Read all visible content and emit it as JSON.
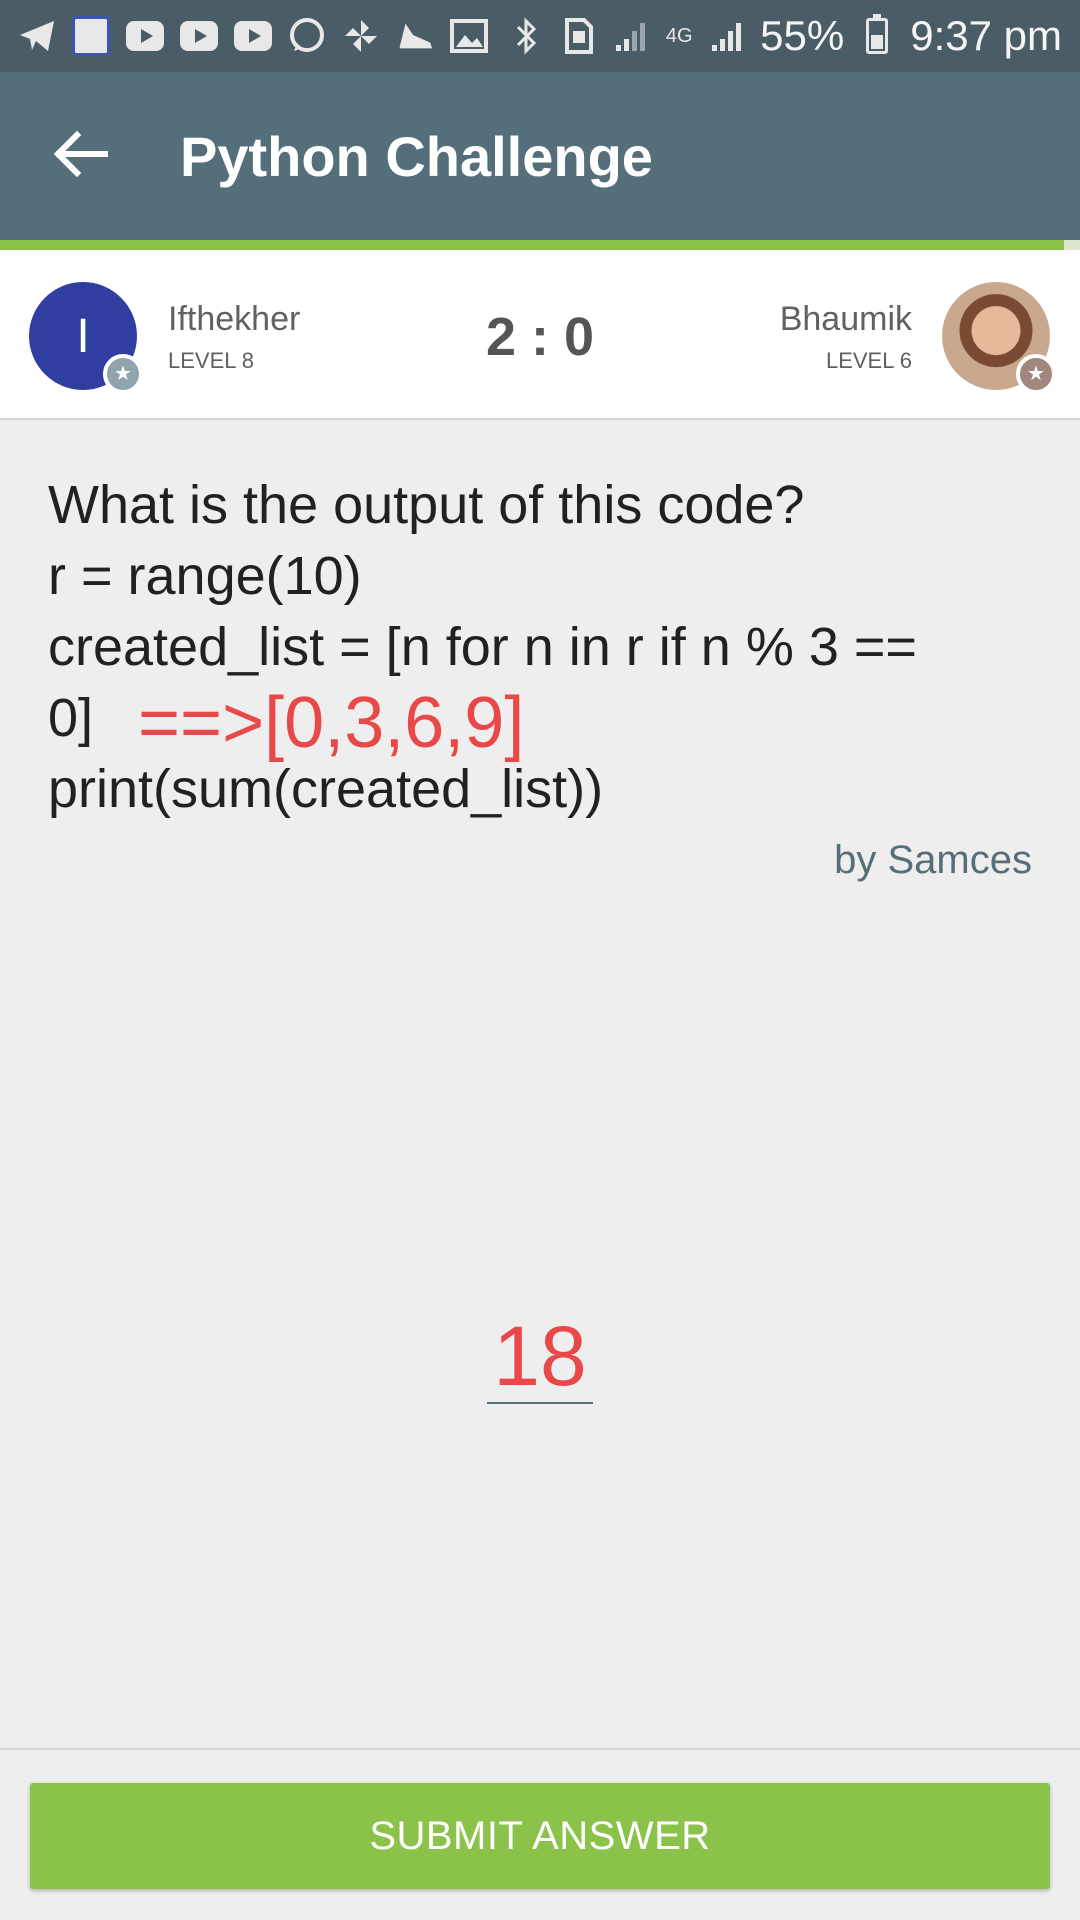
{
  "status_bar": {
    "network_label": "4G",
    "battery_text": "55%",
    "time": "9:37 pm",
    "icons": [
      "telegram-icon",
      "news-app-icon",
      "youtube-icon",
      "youtube-icon",
      "youtube-icon",
      "whatsapp-icon",
      "pinwheel-icon",
      "shoe-icon",
      "image-icon",
      "bluetooth-icon",
      "sim-icon",
      "signal-icon",
      "signal-icon",
      "battery-icon"
    ]
  },
  "app_bar": {
    "title": "Python Challenge",
    "back_icon": "arrow-left-icon",
    "background": "#546e7a"
  },
  "progress": {
    "fraction": 0.985,
    "color": "#8bc34a"
  },
  "players": {
    "left": {
      "initial": "I",
      "name": "Ifthekher",
      "level": "LEVEL 8",
      "avatar_color": "#303f9f",
      "badge_icon": "star-icon"
    },
    "right": {
      "name": "Bhaumik",
      "level": "LEVEL 6",
      "badge_icon": "star-icon"
    },
    "score": "2 : 0"
  },
  "question": {
    "lines": [
      "What is the output of this code?",
      "r = range(10)",
      "created_list = [n for n in r if n % 3 ==",
      "0]",
      "print(sum(created_list))"
    ],
    "annotation": "==>[0,3,6,9]",
    "author": "by Samces"
  },
  "answer": {
    "value": "18",
    "color": "#e84848"
  },
  "submit": {
    "label": "SUBMIT ANSWER",
    "color": "#8bc34a"
  }
}
